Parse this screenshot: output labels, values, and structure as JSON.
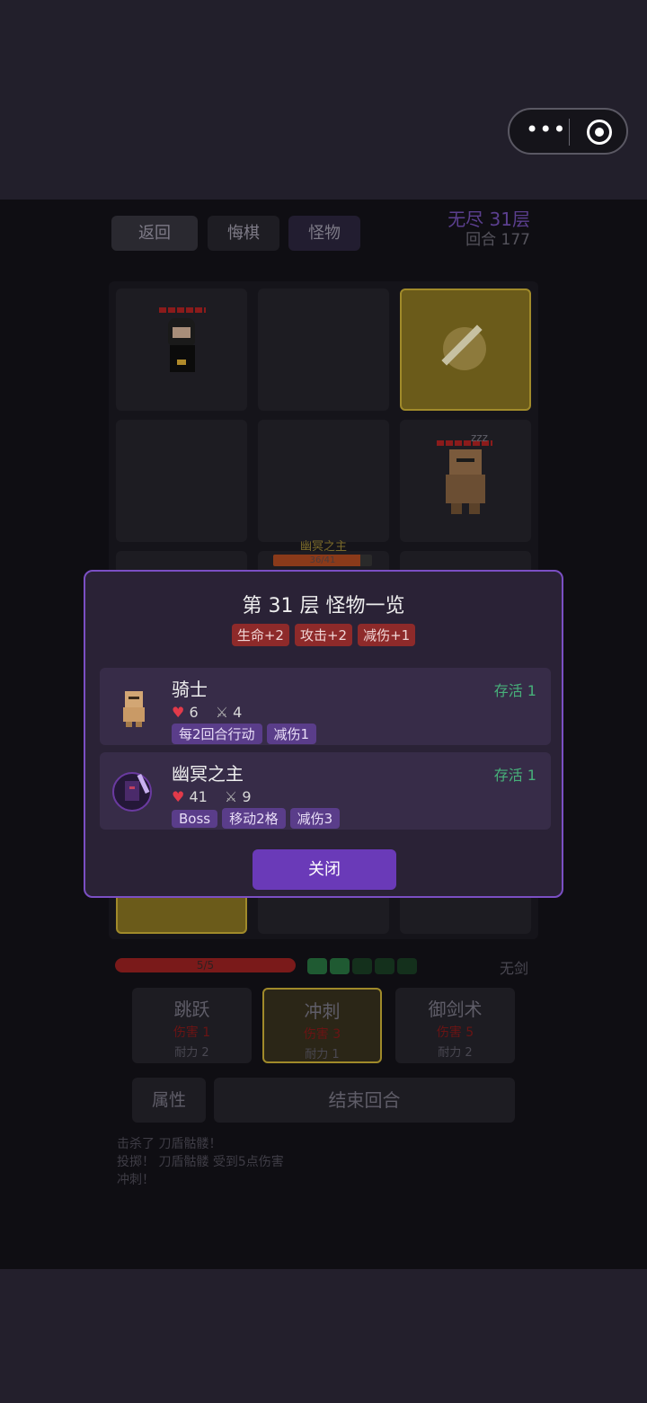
{
  "top_buttons": {
    "back": "返回",
    "undo": "悔棋",
    "monsters": "怪物"
  },
  "floor": {
    "mode": "无尽 31层",
    "round": "回合 177"
  },
  "board": {
    "boss_name": "幽冥之主",
    "boss_hp": "36/41",
    "boss_hp_fraction": 0.878,
    "knight_sleep": "zzz"
  },
  "player": {
    "hp": "5/5",
    "stamina_total": 5,
    "stamina_filled": 2,
    "weapon": "无剑"
  },
  "skills": [
    {
      "name": "跳跃",
      "dmg": "伤害 1",
      "cost": "耐力 2"
    },
    {
      "name": "冲刺",
      "dmg": "伤害 3",
      "cost": "耐力 1"
    },
    {
      "name": "御剑术",
      "dmg": "伤害 5",
      "cost": "耐力 2"
    }
  ],
  "bottom_buttons": {
    "attributes": "属性",
    "end_turn": "结束回合"
  },
  "log": [
    "击杀了 刀盾骷髅！",
    "投掷！ 刀盾骷髅 受到5点伤害",
    "冲刺！"
  ],
  "modal": {
    "title": "第 31 层 怪物一览",
    "modifiers": [
      "生命+2",
      "攻击+2",
      "减伤+1"
    ],
    "monsters": [
      {
        "name": "骑士",
        "alive": "存活 1",
        "hp": "6",
        "atk": "4",
        "tags": [
          "每2回合行动",
          "减伤1"
        ]
      },
      {
        "name": "幽冥之主",
        "alive": "存活 1",
        "hp": "41",
        "atk": "9",
        "tags": [
          "Boss",
          "移动2格",
          "减伤3"
        ]
      }
    ],
    "close": "关闭"
  },
  "colors": {
    "accent": "#7b4fc4",
    "modal_bg": "#2a2236",
    "danger": "#8e2a2a",
    "alive": "#47b07a",
    "gold": "#a08a2a"
  }
}
